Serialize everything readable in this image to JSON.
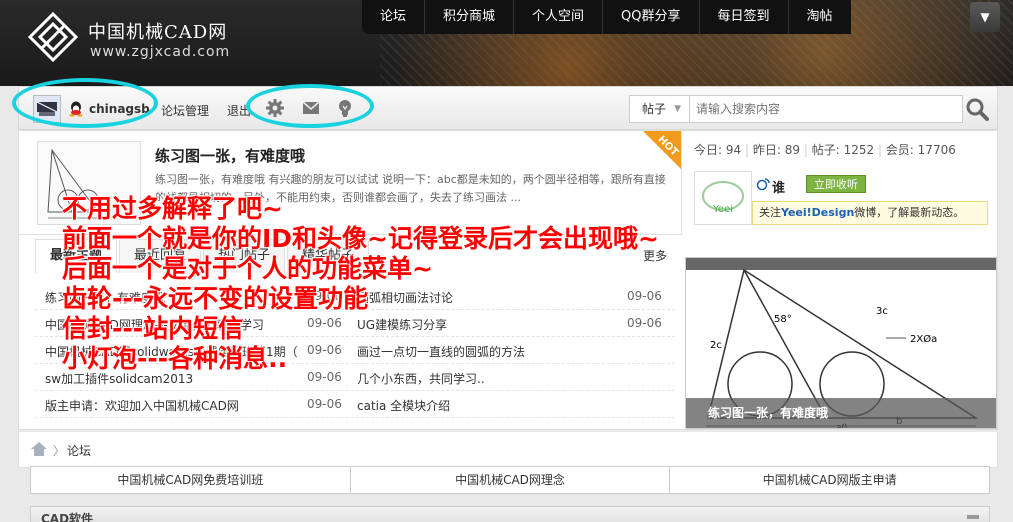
{
  "site": {
    "title": "中国机械CAD网",
    "url": "www.zgjxcad.com"
  },
  "topnav": [
    "论坛",
    "积分商城",
    "个人空间",
    "QQ群分享",
    "每日签到",
    "淘帖"
  ],
  "user": {
    "name": "chinagsb",
    "forum_admin": "论坛管理",
    "logout": "退出"
  },
  "toolbar_icons": [
    "gear-icon",
    "envelope-icon",
    "lightbulb-icon"
  ],
  "search": {
    "type": "帖子",
    "placeholder": "请输入搜索内容"
  },
  "featured": {
    "title": "练习图一张，有难度哦",
    "desc": "练习图一张，有难度哦 有兴趣的朋友可以试试 说明一下：abc都是未知的，两个圆半径相等，跟所有直接的线都是相切的，另外，不能用约束，否则谁都会画了，失去了练习画法 ...",
    "badge": "HOT"
  },
  "stats": {
    "today_label": "今日:",
    "today": "94",
    "yesterday_label": "昨日:",
    "yesterday": "89",
    "posts_label": "帖子:",
    "posts": "1252",
    "members_label": "会员:",
    "members": "17706"
  },
  "follow": {
    "logo_text": "Yeei",
    "name": "谁",
    "button": "立即收听",
    "text_prefix": "关注",
    "brand": "Yeei!Design",
    "text_suffix": "微博，了解最新动态。"
  },
  "tabs": [
    "最新主题",
    "最近回复",
    "热门帖子",
    "精华帖子"
  ],
  "tab_more": "更多",
  "threads": [
    {
      "left": "练习图一张，有难度哦",
      "left_date": "09-06",
      "right": "圆弧相切画法讨论",
      "right_date": "09-06"
    },
    {
      "left": "中国机械CAD网理念---交流，分享，学习",
      "left_date": "09-06",
      "right": "UG建模练习分享",
      "right_date": "09-06"
    },
    {
      "left": "中国机械CAD网solidworks免费学习班第1期（",
      "left_date": "09-06",
      "right": "画过一点切一直线的圆弧的方法",
      "right_date": ""
    },
    {
      "left": "sw加工插件solidcam2013",
      "left_date": "09-06",
      "right": "几个小东西，共同学习..",
      "right_date": ""
    },
    {
      "left": "版主申请：欢迎加入中国机械CAD网",
      "left_date": "09-06",
      "right": "catia 全模块介绍",
      "right_date": ""
    }
  ],
  "gallery": {
    "caption": "练习图一张，有难度哦",
    "dims": [
      "58°",
      "2XØa",
      "2c",
      "3c",
      "b",
      "a0"
    ]
  },
  "breadcrumb": {
    "home": "home-icon",
    "forum": "论坛"
  },
  "quicklinks": [
    "中国机械CAD网免费培训班",
    "中国机械CAD网理念",
    "中国机械CAD网版主申请"
  ],
  "section": {
    "title": "CAD软件"
  },
  "annotation": [
    "不用过多解释了吧~",
    "前面一个就是你的ID和头像~记得登录后才会出现哦~",
    "后面一个是对于个人的功能菜单~",
    "齿轮---永远不变的设置功能",
    "信封---站内短信",
    "小灯泡---各种消息.."
  ],
  "colors": {
    "annotation": "#ff0000",
    "highlight_ring": "#18d2e0",
    "hot_badge": "#f29a1d",
    "follow_button": "#7cb342"
  }
}
